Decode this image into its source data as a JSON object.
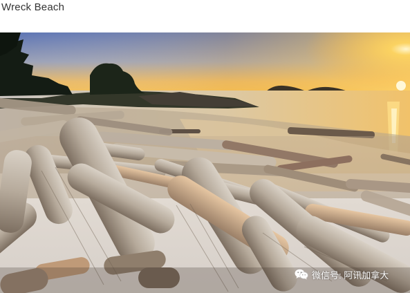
{
  "title": "Wreck Beach",
  "photo": {
    "subject": "driftwood-beach-sunset",
    "colors": {
      "sky_top": "#5a73b5",
      "sky_horizon": "#f6b64a",
      "sun": "#fff3c2",
      "water": "#d9c7a6",
      "driftwood": "#b9ab98",
      "forest": "#1f2a1c"
    }
  },
  "watermark": {
    "icon": "wechat-icon",
    "text": "微信号: 阿讯加拿大"
  }
}
